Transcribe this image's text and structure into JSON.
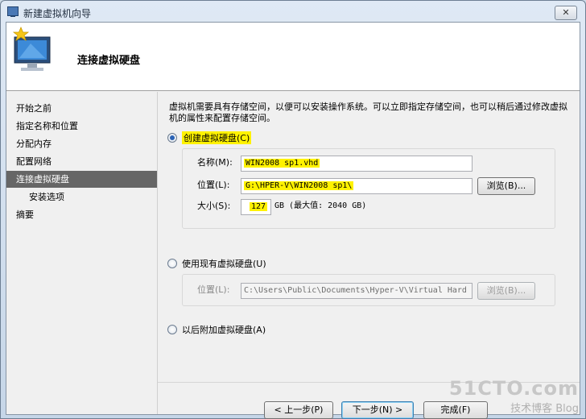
{
  "window": {
    "title": "新建虚拟机向导",
    "close_label": "✕"
  },
  "header": {
    "page_title": "连接虚拟硬盘",
    "icon": "monitor-star-icon"
  },
  "nav": {
    "items": [
      {
        "label": "开始之前"
      },
      {
        "label": "指定名称和位置"
      },
      {
        "label": "分配内存"
      },
      {
        "label": "配置网络"
      },
      {
        "label": "连接虚拟硬盘"
      },
      {
        "label": "安装选项"
      },
      {
        "label": "摘要"
      }
    ]
  },
  "content": {
    "description": "虚拟机需要具有存储空间，以便可以安装操作系统。可以立即指定存储空间，也可以稍后通过修改虚拟机的属性来配置存储空间。",
    "create_option": {
      "label": "创建虚拟硬盘",
      "hotkey": "(C)",
      "name_label": "名称(M):",
      "name_value": "WIN2008 sp1.vhd",
      "location_label": "位置(L):",
      "location_value": "G:\\HPER-V\\WIN2008 sp1\\",
      "browse_label": "浏览(B)...",
      "size_label": "大小(S):",
      "size_value": "127",
      "size_unit": "GB (最大值: 2040 GB)"
    },
    "existing_option": {
      "label": "使用现有虚拟硬盘(U)",
      "location_label": "位置(L):",
      "location_value": "C:\\Users\\Public\\Documents\\Hyper-V\\Virtual Hard D",
      "browse_label": "浏览(B)..."
    },
    "later_option": {
      "label": "以后附加虚拟硬盘(A)"
    }
  },
  "buttons": {
    "prev": "< 上一步(P)",
    "next": "下一步(N) >",
    "finish": "完成(F)"
  },
  "watermark": {
    "main": "51CTO.com",
    "sub": "技术博客 Blog"
  }
}
